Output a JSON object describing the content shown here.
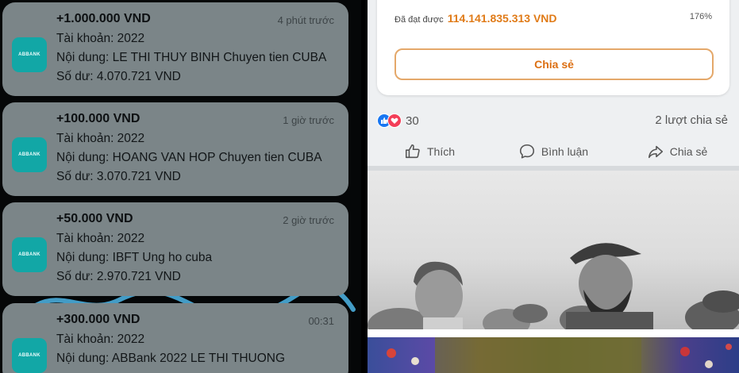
{
  "notifications": [
    {
      "amount": "+1.000.000 VND",
      "time": "4 phút trước",
      "account": "Tài khoản: 2022",
      "content": "Nội dung: LE THI THUY BINH Chuyen tien CUBA",
      "balance": "Số dư: 4.070.721 VND"
    },
    {
      "amount": "+100.000 VND",
      "time": "1 giờ trước",
      "account": "Tài khoản: 2022",
      "content": "Nội dung: HOANG VAN HOP Chuyen tien CUBA",
      "balance": "Số dư: 3.070.721 VND"
    },
    {
      "amount": "+50.000 VND",
      "time": "2 giờ trước",
      "account": "Tài khoản: 2022",
      "content": "Nội dung: IBFT Ung ho cuba",
      "balance": "Số dư: 2.970.721 VND"
    },
    {
      "amount": "+300.000 VND",
      "time": "00:31",
      "account": "Tài khoản: 2022",
      "content": "Nội dung: ABBank 2022 LE THI THUONG",
      "balance": ""
    }
  ],
  "app_icon_text": "ABBANK",
  "post": {
    "achieved_label": "Đã đạt được",
    "achieved_value": "114.141.835.313 VND",
    "percent": "176%",
    "share_button": "Chia sẻ",
    "reaction_count": "30",
    "share_count": "2 lượt chia sẻ",
    "actions": {
      "like": "Thích",
      "comment": "Bình luận",
      "share": "Chia sẻ"
    }
  },
  "colors": {
    "accent": "#dc6f12",
    "notif_bg": "#7b8588",
    "like_blue": "#1877f2",
    "love_red": "#f33e58"
  },
  "icons": [
    "like-reaction-icon",
    "love-reaction-icon",
    "thumbs-up-icon",
    "comment-bubble-icon",
    "share-arrow-icon"
  ]
}
